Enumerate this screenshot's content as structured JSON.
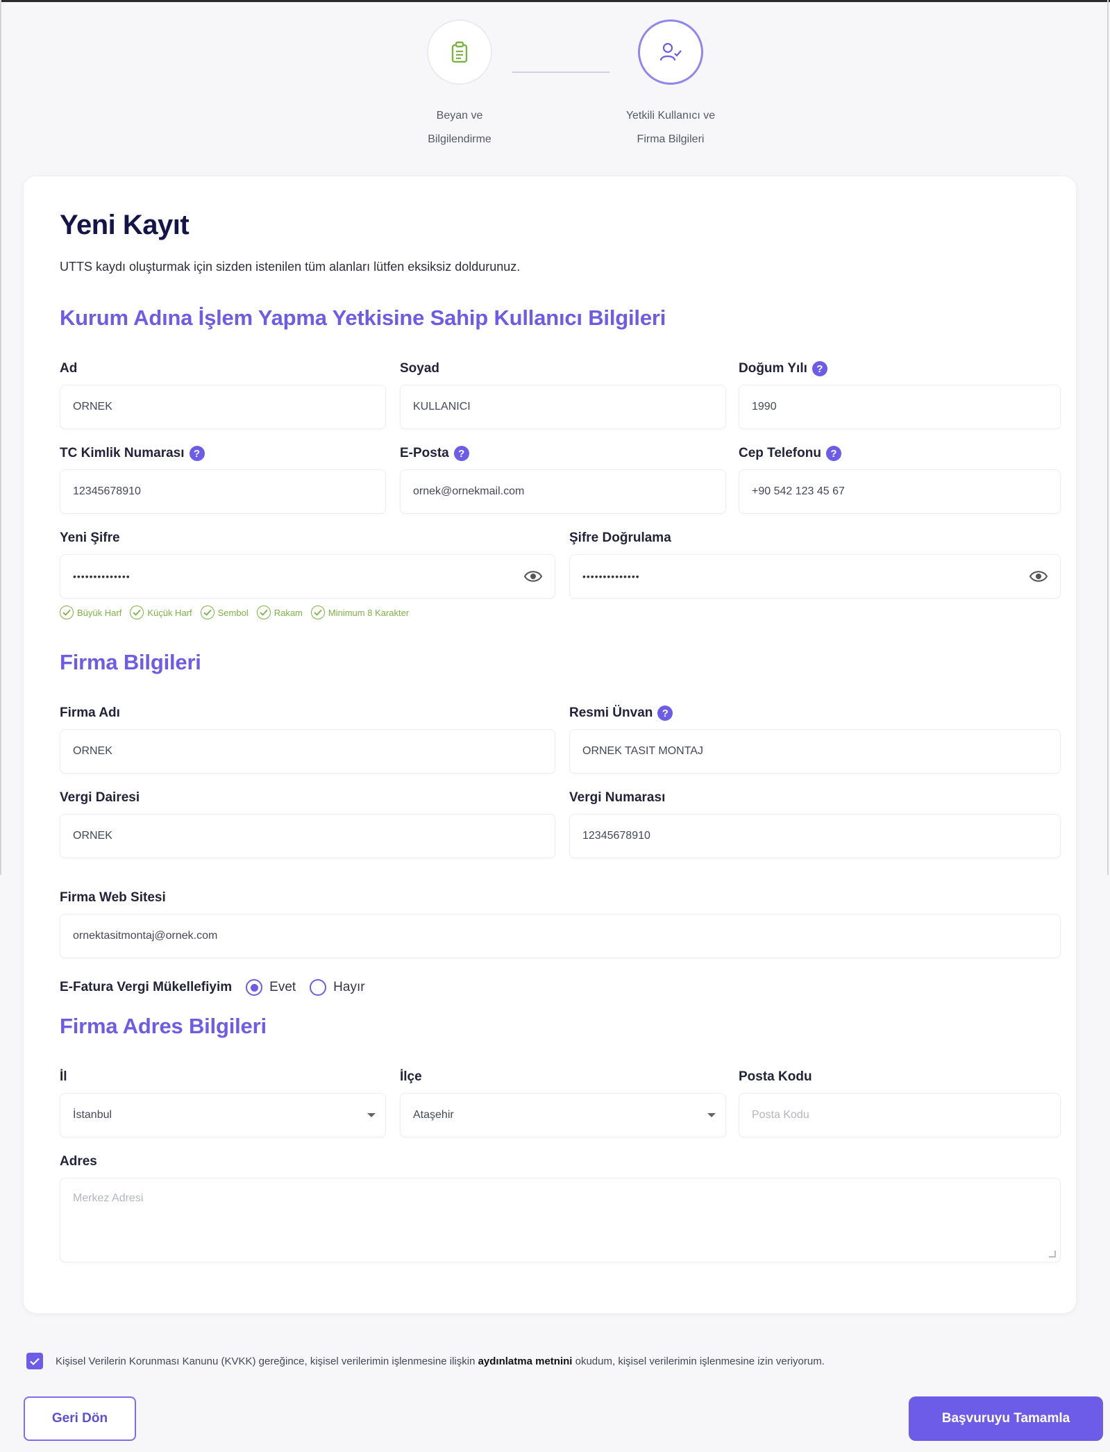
{
  "stepper": {
    "steps": [
      {
        "line1": "Beyan ve",
        "line2": "Bilgilendirme"
      },
      {
        "line1": "Yetkili Kullanıcı ve",
        "line2": "Firma Bilgileri"
      }
    ]
  },
  "page": {
    "title": "Yeni Kayıt",
    "subtitle": "UTTS kaydı oluşturmak için sizden istenilen tüm alanları lütfen eksiksiz doldurunuz."
  },
  "user_section": {
    "title": "Kurum Adına İşlem Yapma Yetkisine Sahip Kullanıcı Bilgileri",
    "ad_label": "Ad",
    "ad_value": "ORNEK",
    "soyad_label": "Soyad",
    "soyad_value": "KULLANICI",
    "dogum_label": "Doğum Yılı",
    "dogum_value": "1990",
    "tc_label": "TC Kimlik Numarası",
    "tc_value": "12345678910",
    "eposta_label": "E-Posta",
    "eposta_value": "ornek@ornekmail.com",
    "cep_label": "Cep Telefonu",
    "cep_value": "+90 542 123 45 67",
    "sifre_label": "Yeni Şifre",
    "sifre_value": "••••••••••••••",
    "sifre2_label": "Şifre Doğrulama",
    "sifre2_value": "••••••••••••••",
    "rules": [
      "Büyük Harf",
      "Küçük Harf",
      "Sembol",
      "Rakam",
      "Minimum 8 Karakter"
    ]
  },
  "firm_section": {
    "title": "Firma Bilgileri",
    "adi_label": "Firma Adı",
    "adi_value": "ORNEK",
    "unvan_label": "Resmi Ünvan",
    "unvan_value": "ORNEK TASIT MONTAJ",
    "vd_label": "Vergi Dairesi",
    "vd_value": "ORNEK",
    "vn_label": "Vergi Numarası",
    "vn_value": "12345678910",
    "web_label": "Firma Web Sitesi",
    "web_value": "ornektasitmontaj@ornek.com",
    "efatura_label": "E-Fatura Vergi Mükellefiyim",
    "efatura_options": [
      "Evet",
      "Hayır"
    ],
    "efatura_selected": "Evet"
  },
  "address_section": {
    "title": "Firma Adres Bilgileri",
    "il_label": "İl",
    "il_value": "İstanbul",
    "ilce_label": "İlçe",
    "ilce_value": "Ataşehir",
    "posta_label": "Posta Kodu",
    "posta_placeholder": "Posta Kodu",
    "adres_label": "Adres",
    "adres_placeholder": "Merkez Adresi"
  },
  "consent": {
    "before": "Kişisel Verilerin Korunması Kanunu (KVKK) gereğince, kişisel verilerimin işlenmesine ilişkin ",
    "link": "aydınlatma metnini",
    "after": " okudum, kişisel verilerimin işlenmesine izin veriyorum.",
    "checked": true
  },
  "actions": {
    "back_label": "Geri Dön",
    "submit_label": "Başvuruyu Tamamla"
  },
  "colors": {
    "accent": "#6c5ce7",
    "success": "#7cb342",
    "title": "#14144a"
  }
}
